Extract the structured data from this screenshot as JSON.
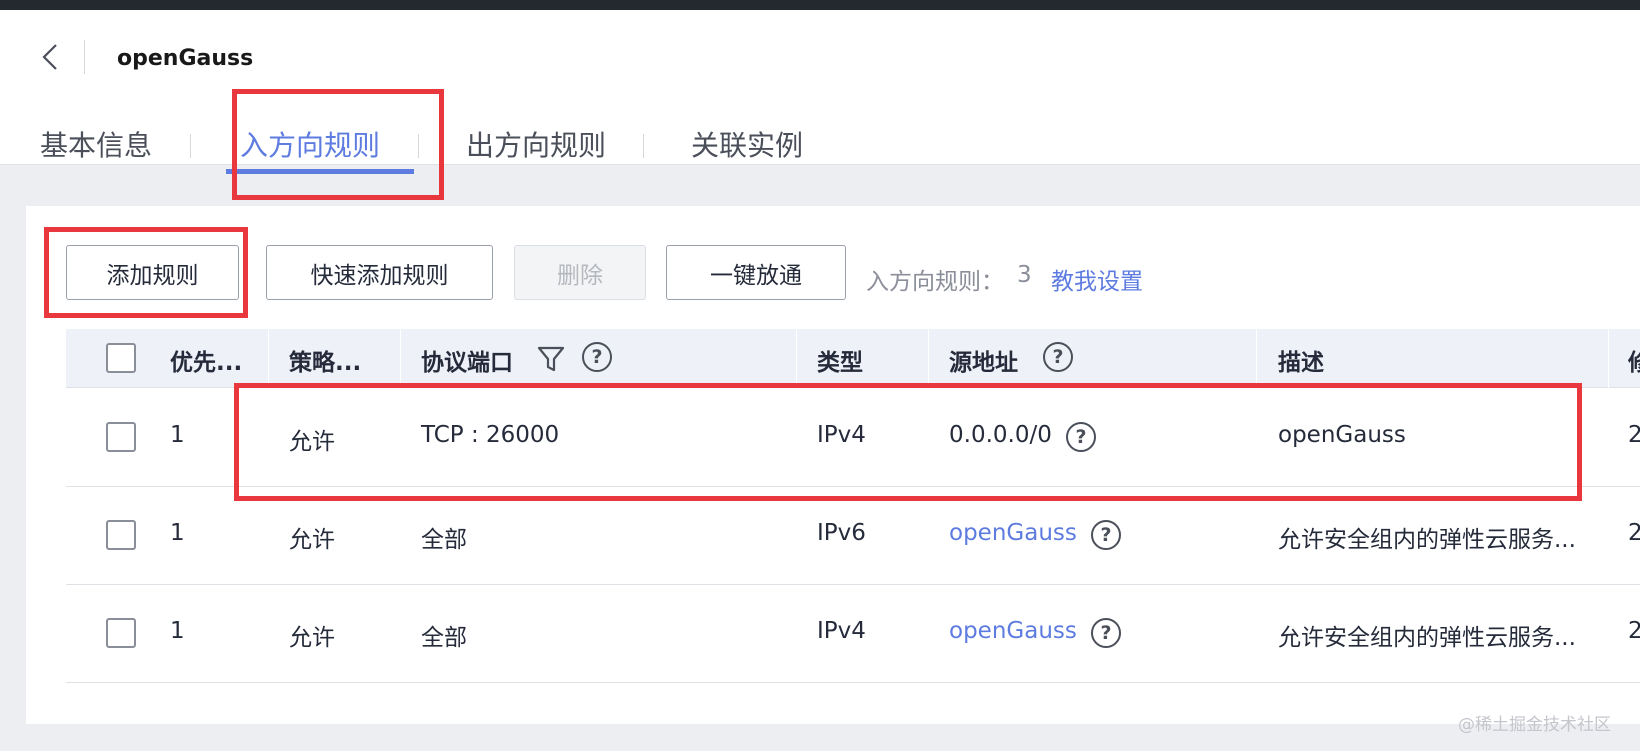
{
  "header": {
    "title": "openGauss",
    "back_icon": "chevron-left-icon"
  },
  "tabs": [
    {
      "label": "基本信息",
      "active": false
    },
    {
      "label": "入方向规则",
      "active": true
    },
    {
      "label": "出方向规则",
      "active": false
    },
    {
      "label": "关联实例",
      "active": false
    }
  ],
  "toolbar": {
    "add_rule": "添加规则",
    "quick_add_rule": "快速添加规则",
    "delete": "删除",
    "one_click_allow": "一键放通",
    "count_label": "入方向规则：",
    "count_value": "3",
    "help_link": "教我设置"
  },
  "table": {
    "columns": [
      "优先...",
      "策略...",
      "协议端口",
      "类型",
      "源地址",
      "描述",
      "修"
    ],
    "rows": [
      {
        "priority": "1",
        "policy": "允许",
        "protocol_port": "TCP : 26000",
        "type": "IPv4",
        "source": "0.0.0.0/0",
        "source_is_link": false,
        "description": "openGauss",
        "extra": "2"
      },
      {
        "priority": "1",
        "policy": "允许",
        "protocol_port": "全部",
        "type": "IPv6",
        "source": "openGauss",
        "source_is_link": true,
        "description": "允许安全组内的弹性云服务...",
        "extra": "2"
      },
      {
        "priority": "1",
        "policy": "允许",
        "protocol_port": "全部",
        "type": "IPv4",
        "source": "openGauss",
        "source_is_link": true,
        "description": "允许安全组内的弹性云服务...",
        "extra": "2"
      }
    ]
  },
  "colors": {
    "accent": "#5e7ce0",
    "highlight": "#e8383d",
    "header_row_bg": "#eef1f8"
  },
  "watermark": "@稀土掘金技术社区"
}
